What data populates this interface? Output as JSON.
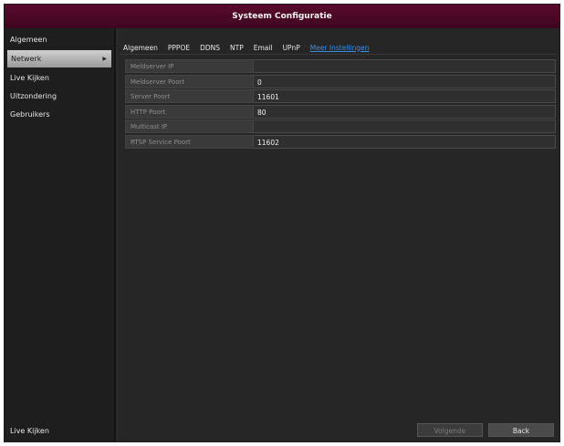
{
  "window": {
    "title": "Systeem Configuratie"
  },
  "sidebar": {
    "items": [
      {
        "label": "Algemeen"
      },
      {
        "label": "Netwerk",
        "active": true
      },
      {
        "label": "Live Kijken"
      },
      {
        "label": "Uitzondering"
      },
      {
        "label": "Gebruikers"
      }
    ],
    "bottom_label": "Live Kijken"
  },
  "tabs": [
    {
      "label": "Algemeen"
    },
    {
      "label": "PPPOE"
    },
    {
      "label": "DDNS"
    },
    {
      "label": "NTP"
    },
    {
      "label": "Email"
    },
    {
      "label": "UPnP"
    },
    {
      "label": "Meer Instellingen",
      "active": true
    }
  ],
  "fields": [
    {
      "label": "Meldserver IP",
      "value": ""
    },
    {
      "label": "Meldserver Poort",
      "value": "0"
    },
    {
      "label": "Server Poort",
      "value": "11601"
    },
    {
      "label": "HTTP Poort",
      "value": "80"
    },
    {
      "label": "Multicast IP",
      "value": ""
    },
    {
      "label": "RTSP Service Poort",
      "value": "11602"
    }
  ],
  "buttons": {
    "next": "Volgende",
    "back": "Back"
  },
  "colors": {
    "titlebar": "#4a0826",
    "active_tab": "#3a8fe0"
  }
}
